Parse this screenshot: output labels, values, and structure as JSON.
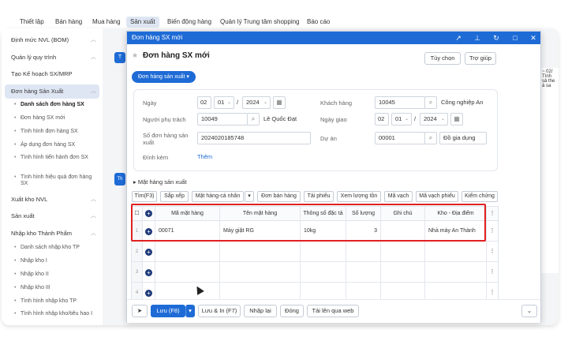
{
  "topnav": {
    "items": [
      "Thiết lập",
      "Bán hàng",
      "Mua hàng",
      "Sản xuất",
      "Biến động hàng",
      "Quản lý Trung tâm shopping",
      "Báo cáo"
    ]
  },
  "sidebar": {
    "items": [
      "Định mức NVL (BOM)",
      "Quản lý quy trình",
      "Tạo Kế hoạch SX/MRP",
      "Đơn hàng Sản Xuất",
      "Danh sách đơn hàng SX",
      "Đơn hàng SX mới",
      "Tình hình đơn hàng SX",
      "Áp dụng đơn hàng SX",
      "Tình hình tiến hành đơn SX",
      "Tình hình hiệu quả đơn hàng SX",
      "Xuất kho NVL",
      "Sản xuất",
      "Nhập kho Thành Phẩm",
      "Danh sách nhập kho TP",
      "Nhập kho I",
      "Nhập kho II",
      "Nhập kho III",
      "Tình hình nhập kho TP",
      "Tình hình nhập kho/tiêu hao I"
    ]
  },
  "right_panel": {
    "text": "~ 02/ Tình sả the ả sa"
  },
  "modal": {
    "title": "Đơn hàng SX mới",
    "heading": "Đơn hàng SX mới",
    "options_button": "Tùy chọn",
    "help_button": "Trợ giúp",
    "type_pill": "Đơn hàng sản xuất",
    "form": {
      "date_label": "Ngày",
      "date_day": "02",
      "date_month": "01",
      "date_year": "2024",
      "customer_label": "Khách hàng",
      "customer_code": "10045",
      "customer_name": "Công nghiệp An",
      "person_label": "Người phụ trách",
      "person_code": "10049",
      "person_name": "Lê Quốc Đạt",
      "delivery_label": "Ngày giao",
      "delivery_day": "02",
      "delivery_month": "01",
      "delivery_year": "2024",
      "order_no_label": "Số đơn hàng sản xuất",
      "order_no": "2024020185748",
      "project_label": "Dự án",
      "project_code": "00001",
      "project_name": "Đồ gia dụng",
      "attach_label": "Đính kèm",
      "attach_link": "Thêm",
      "slash": "/"
    },
    "section_label": "Mặt hàng sản xuất",
    "toolbar": [
      "Tìm(F3)",
      "Sắp xếp",
      "Mặt hàng-cá nhân",
      "Đơn bán hàng",
      "Tải phiếu",
      "Xem lượng tồn",
      "Mã vạch",
      "Mã vạch phiếu",
      "Kiểm chứng"
    ],
    "grid": {
      "headers": [
        "Mã mặt hàng",
        "Tên mặt hàng",
        "Thông số đặc tả",
        "Số lượng",
        "Ghi chú",
        "Kho - Địa điểm"
      ],
      "rows": [
        {
          "num": "1",
          "code": "00071",
          "name": "Máy giặt RG",
          "spec": "10kg",
          "qty": "3",
          "note": "",
          "warehouse": "Nhà máy An Thành"
        },
        {
          "num": "2",
          "code": "",
          "name": "",
          "spec": "",
          "qty": "",
          "note": "",
          "warehouse": ""
        },
        {
          "num": "3",
          "code": "",
          "name": "",
          "spec": "",
          "qty": "",
          "note": "",
          "warehouse": ""
        },
        {
          "num": "4",
          "code": "",
          "name": "",
          "spec": "",
          "qty": "",
          "note": "",
          "warehouse": ""
        }
      ]
    },
    "footer": {
      "save": "Lưu (F8)",
      "save_print": "Lưu & In (F7)",
      "reset": "Nhập lại",
      "close": "Đóng",
      "upload": "Tải lên qua web"
    }
  },
  "colors": {
    "accent": "#1e6bd6",
    "highlight": "#e02020",
    "active_bg": "#dfe6f3"
  }
}
